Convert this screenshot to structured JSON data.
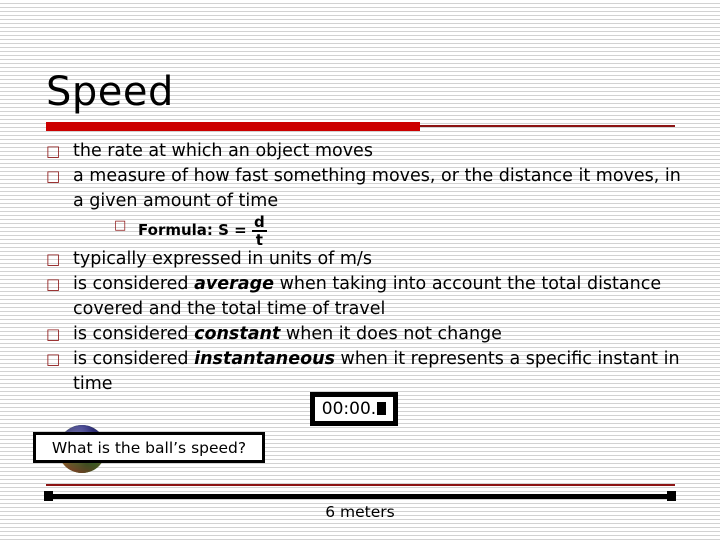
{
  "slide": {
    "title": "Speed",
    "accent_color": "#cc0000",
    "accent_dark_color": "#8c1414",
    "background_color": "#ffffff"
  },
  "bullets": [
    {
      "level": 1,
      "marker": "square-bullet",
      "marker_glyph": "□",
      "text": "the rate at which an object moves"
    },
    {
      "level": 1,
      "marker": "square-bullet",
      "marker_glyph": "□",
      "text": "a measure of how fast something moves, or the distance it moves, in a given amount of time"
    },
    {
      "level": 2,
      "marker": "square-bullet",
      "marker_glyph": "□",
      "label": "Formula:  S  =  ",
      "formula_numerator": "d",
      "formula_denominator": "t"
    },
    {
      "level": 1,
      "marker": "square-bullet",
      "marker_glyph": "□",
      "text": "typically expressed in units of m/s"
    },
    {
      "level": 1,
      "marker": "square-bullet",
      "marker_glyph": "□",
      "pre": "is considered ",
      "emphasis": "average",
      "post": " when taking into account the total distance covered and the total time of travel"
    },
    {
      "level": 1,
      "marker": "square-bullet",
      "marker_glyph": "□",
      "pre": "is considered ",
      "emphasis": "constant",
      "post": " when it does not change"
    },
    {
      "level": 1,
      "marker": "square-bullet",
      "marker_glyph": "□",
      "pre": "is considered ",
      "emphasis": "instantaneous",
      "post": " when it represents a specific instant in time"
    }
  ],
  "timer": {
    "display": "00:00.",
    "cursor": "block-cursor"
  },
  "question": {
    "text": "What is the ball’s speed?"
  },
  "measurement": {
    "label": "6 meters"
  },
  "ball": {
    "name": "beach-ball"
  }
}
